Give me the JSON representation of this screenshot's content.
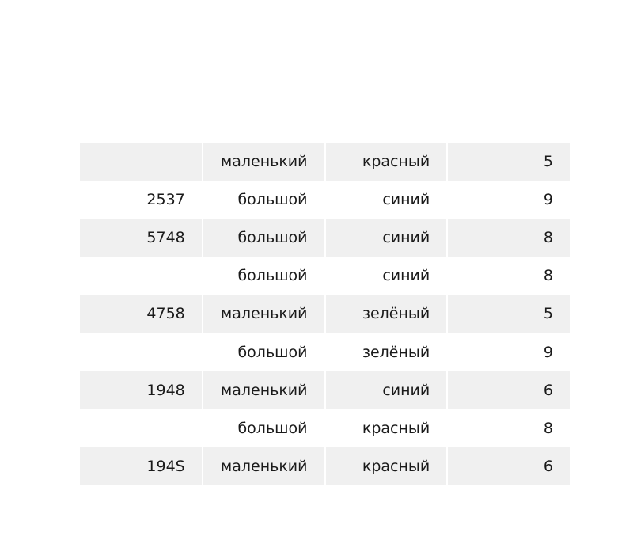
{
  "chart_data": {
    "type": "table",
    "rows": [
      [
        "",
        "маленький",
        "красный",
        "5"
      ],
      [
        "2537",
        "большой",
        "синий",
        "9"
      ],
      [
        "5748",
        "большой",
        "синий",
        "8"
      ],
      [
        "",
        "большой",
        "синий",
        "8"
      ],
      [
        "4758",
        "маленький",
        "зелёный",
        "5"
      ],
      [
        "",
        "большой",
        "зелёный",
        "9"
      ],
      [
        "1948",
        "маленький",
        "синий",
        "6"
      ],
      [
        "",
        "большой",
        "красный",
        "8"
      ],
      [
        "194S",
        "маленький",
        "красный",
        "6"
      ]
    ],
    "colors": {
      "band": "#f0f0f0",
      "background": "#ffffff",
      "text": "#1a1a1a"
    }
  }
}
